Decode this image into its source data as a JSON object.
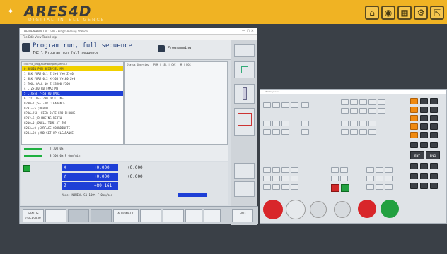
{
  "app": {
    "logo_text": "ARES4D",
    "logo_sub": "DIGITAL  INTELLIGENCE",
    "toolbar_icons": [
      "home-icon",
      "camera-icon",
      "grid-icon",
      "gear-icon",
      "door-icon"
    ]
  },
  "cnc_window": {
    "title": "HEIDENHAIN TNC 640 - Programming Station",
    "menu": "File  Edit  View  Tools  Help",
    "header_title": "Program run, full sequence",
    "header_sub": "TNC:\\ Program run full sequence",
    "mode_label": "Programming",
    "program_header": "TNC:\\nc_prog\\PGM\\Beispiel\\Demo.h",
    "program_lines": [
      "0  BEGIN PGM BEISPIEL MM",
      "1  BLK FORM 0.1 Z X+0 Y+0 Z-40",
      "2  BLK FORM 0.2 X+100 Y+100 Z+0",
      "3  TOOL CALL 10 Z S3500 F500",
      "4  L Z+100 R0 FMAX M3",
      "5  L X+50 Y+50 R0 FMAX",
      "6  CYCL DEF 200 DRILLING",
      "   Q200=2  ;SET-UP CLEARANCE",
      "   Q201=-5 ;DEPTH",
      "   Q206=150 ;FEED RATE FOR PLNGNG",
      "   Q202=5  ;PLUNGING DEPTH",
      "   Q210=0  ;DWELL TIME AT TOP",
      "   Q203=+0 ;SURFACE COORDINATE",
      "   Q204=50 ;2ND SET-UP CLEARANCE"
    ],
    "info_header": "Status Overview | PGM | LBL | CYC | M | POS",
    "status_line1": "T  100.0%",
    "status_line2": "S  100.0%   F  0mm/min",
    "axes": [
      {
        "axis": "X",
        "value": "+0.000",
        "value2": "+0.000"
      },
      {
        "axis": "Y",
        "value": "+0.000",
        "value2": "+0.000"
      },
      {
        "axis": "Z",
        "value": "+89.161",
        "value2": ""
      }
    ],
    "feed_row": "Mode: NOMINL     S1   100%     F 0mm/min",
    "softkeys": [
      "STATUS OVERVIEW",
      "",
      "",
      "",
      "AUTOMATIC",
      "",
      "",
      "",
      "",
      "",
      "END"
    ]
  },
  "keyboard_window": {
    "title": "TNC Keyboard"
  }
}
